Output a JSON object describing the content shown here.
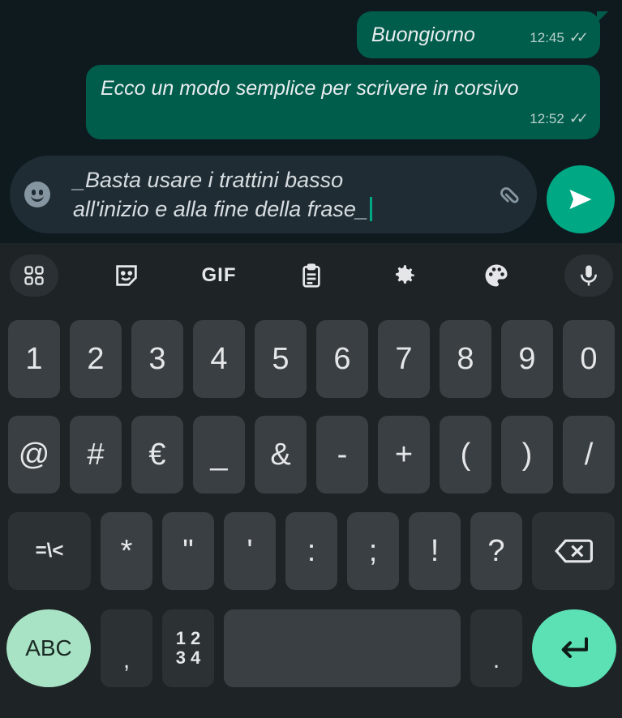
{
  "chat": {
    "messages": [
      {
        "text": "Buongiorno",
        "time": "12:45"
      },
      {
        "text": "Ecco un modo semplice per scrivere in corsivo",
        "time": "12:52"
      }
    ]
  },
  "composer": {
    "text": "_Basta usare i trattini basso\nall'inizio e alla fine della frase_"
  },
  "keyboard": {
    "toolbar": {
      "gif_label": "GIF"
    },
    "row_numbers": [
      "1",
      "2",
      "3",
      "4",
      "5",
      "6",
      "7",
      "8",
      "9",
      "0"
    ],
    "row_symbols": [
      "@",
      "#",
      "€",
      "_",
      "&",
      "-",
      "+",
      "(",
      ")",
      "/"
    ],
    "row_punct": [
      "=\\<",
      "*",
      "\"",
      "'",
      ":",
      ";",
      "!",
      "?"
    ],
    "bottom": {
      "abc": "ABC",
      "comma": ",",
      "numpad_top": "1 2",
      "numpad_bottom": "3 4",
      "period": "."
    }
  },
  "colors": {
    "outgoing_bubble": "#005c4b",
    "accent": "#00a884",
    "enter_key": "#5be1b4"
  }
}
